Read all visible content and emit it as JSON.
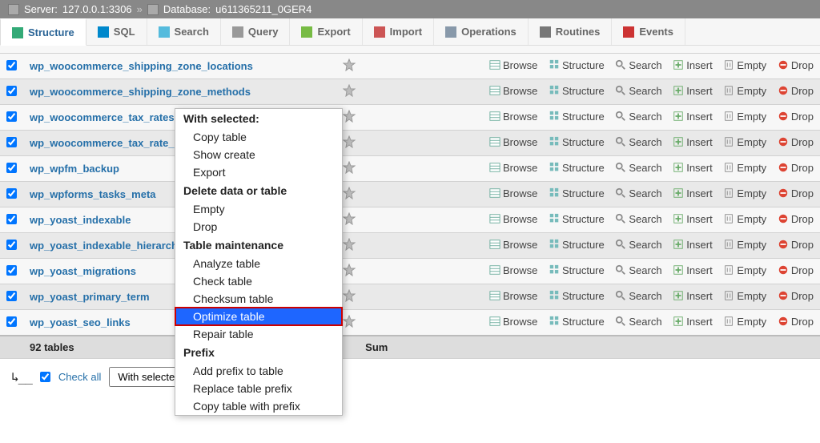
{
  "breadcrumb": {
    "server_label": "Server:",
    "server_value": "127.0.0.1:3306",
    "db_label": "Database:",
    "db_value": "u611365211_0GER4"
  },
  "tabs": [
    {
      "label": "Structure",
      "active": true
    },
    {
      "label": "SQL",
      "active": false
    },
    {
      "label": "Search",
      "active": false
    },
    {
      "label": "Query",
      "active": false
    },
    {
      "label": "Export",
      "active": false
    },
    {
      "label": "Import",
      "active": false
    },
    {
      "label": "Operations",
      "active": false
    },
    {
      "label": "Routines",
      "active": false
    },
    {
      "label": "Events",
      "active": false
    }
  ],
  "action_labels": {
    "browse": "Browse",
    "structure": "Structure",
    "search": "Search",
    "insert": "Insert",
    "empty": "Empty",
    "drop": "Drop"
  },
  "rows": [
    {
      "name": "wp_woocommerce_shipping_zone_locations",
      "checked": true
    },
    {
      "name": "wp_woocommerce_shipping_zone_methods",
      "checked": true
    },
    {
      "name": "wp_woocommerce_tax_rates",
      "checked": true
    },
    {
      "name": "wp_woocommerce_tax_rate_locations",
      "checked": true,
      "truncated": "wp_woocommerce_ta"
    },
    {
      "name": "wp_wpfm_backup",
      "checked": true
    },
    {
      "name": "wp_wpforms_tasks_meta",
      "checked": true,
      "truncated": "wp_wpforms_tasks_m"
    },
    {
      "name": "wp_yoast_indexable",
      "checked": true
    },
    {
      "name": "wp_yoast_indexable_hierarchy",
      "checked": true,
      "truncated": "wp_yoast_indexable_"
    },
    {
      "name": "wp_yoast_migrations",
      "checked": true
    },
    {
      "name": "wp_yoast_primary_term",
      "checked": true,
      "truncated": "wp_yoast_primary_te"
    },
    {
      "name": "wp_yoast_seo_links",
      "checked": true
    }
  ],
  "summary": {
    "tables": "92 tables",
    "sum": "Sum"
  },
  "footer": {
    "check_all": "Check all",
    "select_label": "With selected:"
  },
  "ctx": {
    "header1": "With selected:",
    "items1": [
      "Copy table",
      "Show create",
      "Export"
    ],
    "header2": "Delete data or table",
    "items2": [
      "Empty",
      "Drop"
    ],
    "header3": "Table maintenance",
    "items3": [
      "Analyze table",
      "Check table",
      "Checksum table",
      "Optimize table",
      "Repair table"
    ],
    "selected": "Optimize table",
    "header4": "Prefix",
    "items4": [
      "Add prefix to table",
      "Replace table prefix",
      "Copy table with prefix"
    ]
  }
}
